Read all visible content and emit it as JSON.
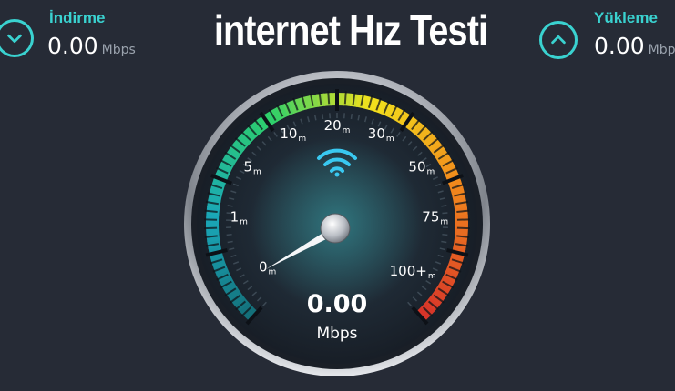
{
  "download": {
    "label": "İndirme",
    "value": "0.00",
    "unit": "Mbps"
  },
  "upload": {
    "label": "Yükleme",
    "value": "0.00",
    "unit": "Mbps"
  },
  "title": "internet Hız Testi",
  "gauge": {
    "value": "0.00",
    "unit": "Mbps",
    "ticks": [
      {
        "num": "0",
        "unit": "m"
      },
      {
        "num": "1",
        "unit": "m"
      },
      {
        "num": "5",
        "unit": "m"
      },
      {
        "num": "10",
        "unit": "m"
      },
      {
        "num": "20",
        "unit": "m"
      },
      {
        "num": "30",
        "unit": "m"
      },
      {
        "num": "50",
        "unit": "m"
      },
      {
        "num": "75",
        "unit": "m"
      },
      {
        "num": "100+",
        "unit": "m"
      }
    ],
    "colors": {
      "accent": "#3ad2d0",
      "wifi": "#39c8f0",
      "arc_green": "#2ed06a",
      "arc_yellow": "#f2e21c",
      "arc_orange": "#f28a1c",
      "arc_red": "#d6302a"
    },
    "icon": "wifi-icon"
  }
}
